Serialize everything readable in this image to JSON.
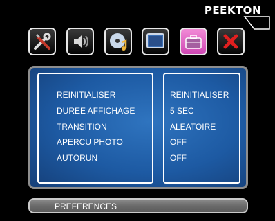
{
  "brand": {
    "name": "PEEKTON"
  },
  "toolbar": {
    "icons": [
      "tools-icon",
      "speaker-icon",
      "disc-music-icon",
      "screen-icon",
      "briefcase-icon",
      "close-icon"
    ],
    "active_index": 4
  },
  "settings": {
    "labels": [
      "REINITIALISER",
      "DUREE AFFICHAGE",
      "TRANSITION",
      "APERCU PHOTO",
      "AUTORUN"
    ],
    "values": [
      "REINITIALISER",
      "5 SEC",
      "ALEATOIRE",
      "OFF",
      "OFF"
    ]
  },
  "status": {
    "title": "PREFERENCES"
  },
  "colors": {
    "panel": "#1d5aa3",
    "active_tab": "#e067c7",
    "close": "#e01f1f"
  }
}
